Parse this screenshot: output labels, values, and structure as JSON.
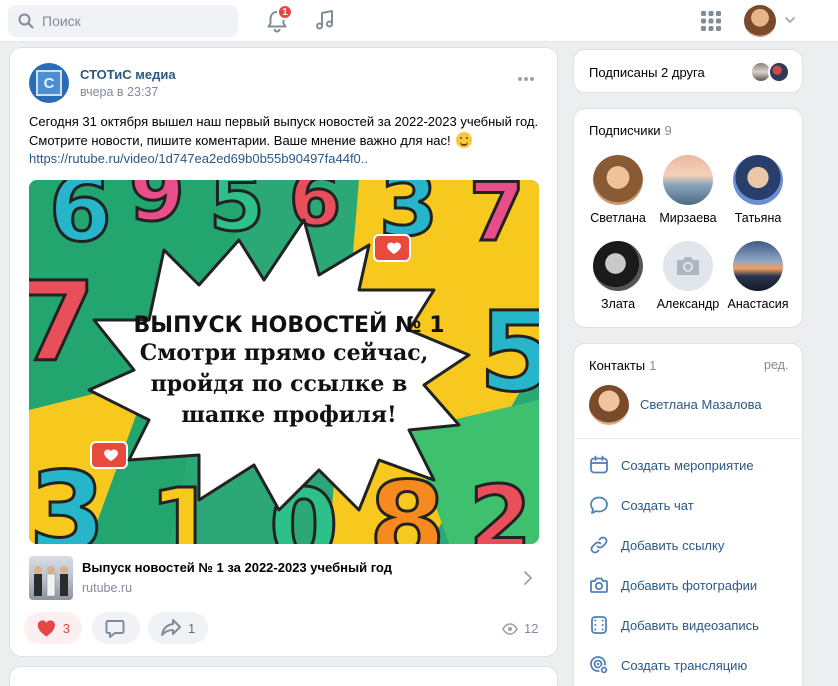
{
  "topbar": {
    "search_placeholder": "Поиск",
    "notifications_count": "1"
  },
  "post": {
    "author": "СТОТиС медиа",
    "time": "вчера в 23:37",
    "text": "Сегодня 31 октября вышел наш первый выпуск новостей за 2022-2023 учебный год. Смотрите новости, пишите коментарии. Ваше мнение важно для нас!",
    "link": "https://rutube.ru/video/1d747ea2ed69b0b55b90497fa44f0..",
    "image": {
      "headline": "ВЫПУСК НОВОСТЕЙ № 1",
      "line1": "Смотри прямо сейчас,",
      "line2": "пройдя по ссылке в",
      "line3": "шапке профиля!"
    },
    "snippet": {
      "title": "Выпуск новостей № 1 за 2022-2023 учебный год",
      "domain": "rutube.ru"
    },
    "likes": "3",
    "shares": "1",
    "views": "12"
  },
  "friends": {
    "label": "Подписаны 2 друга"
  },
  "subscribers": {
    "title": "Подписчики",
    "count": "9",
    "items": [
      {
        "name": "Светлана"
      },
      {
        "name": "Мирзаева"
      },
      {
        "name": "Татьяна"
      },
      {
        "name": "Злата"
      },
      {
        "name": "Александр"
      },
      {
        "name": "Анастасия"
      }
    ]
  },
  "contacts": {
    "title": "Контакты",
    "count": "1",
    "edit": "ред.",
    "person": "Светлана Мазалова",
    "actions": [
      {
        "label": "Создать мероприятие",
        "icon": "calendar-icon"
      },
      {
        "label": "Создать чат",
        "icon": "chat-icon"
      },
      {
        "label": "Добавить ссылку",
        "icon": "link-icon"
      },
      {
        "label": "Добавить фотографии",
        "icon": "camera-icon"
      },
      {
        "label": "Добавить видеозапись",
        "icon": "video-icon"
      },
      {
        "label": "Создать трансляцию",
        "icon": "broadcast-icon"
      }
    ]
  },
  "colors": {
    "accent": "#2a5885",
    "like": "#e64646",
    "background": "#edeef0"
  }
}
